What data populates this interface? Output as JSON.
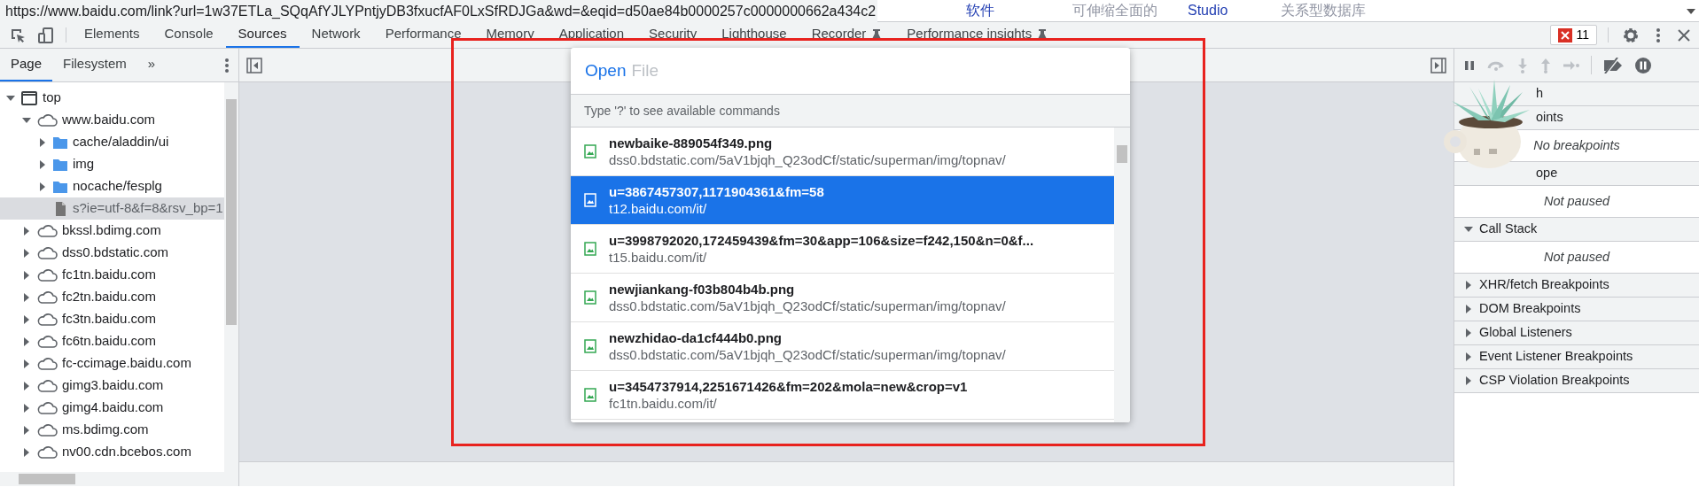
{
  "browser_strip": {
    "url": "https://www.baidu.com/link?url=1w37ETLa_SQqAfYJLYPntjyDB3fxucfAF0LxSfRDJGa&wd=&eqid=d50ae84b0000257c0000000662a434c2",
    "page_texts": [
      {
        "text": "软件",
        "kind": "link"
      },
      {
        "text": "可伸缩全面的",
        "kind": "muted"
      },
      {
        "text": "Studio",
        "kind": "link"
      },
      {
        "text": "关系型数据库",
        "kind": "muted"
      }
    ]
  },
  "devtools_tabs": [
    {
      "label": "Elements",
      "selected": false
    },
    {
      "label": "Console",
      "selected": false
    },
    {
      "label": "Sources",
      "selected": true
    },
    {
      "label": "Network",
      "selected": false
    },
    {
      "label": "Performance",
      "selected": false
    },
    {
      "label": "Memory",
      "selected": false
    },
    {
      "label": "Application",
      "selected": false
    },
    {
      "label": "Security",
      "selected": false
    },
    {
      "label": "Lighthouse",
      "selected": false
    },
    {
      "label": "Recorder",
      "selected": false,
      "experimental": true
    },
    {
      "label": "Performance insights",
      "selected": false,
      "experimental": true
    }
  ],
  "error_count": "11",
  "navigator": {
    "tabs": [
      {
        "label": "Page",
        "selected": true
      },
      {
        "label": "Filesystem",
        "selected": false
      }
    ],
    "more": "»",
    "tree": [
      {
        "label": "top",
        "kind": "frame",
        "expanded": true,
        "selected": false,
        "children": [
          {
            "label": "www.baidu.com",
            "kind": "domain",
            "expanded": true,
            "selected": false,
            "children": [
              {
                "label": "cache/aladdin/ui",
                "kind": "folder",
                "expanded": false,
                "selected": false
              },
              {
                "label": "img",
                "kind": "folder",
                "expanded": false,
                "selected": false
              },
              {
                "label": "nocache/fesplg",
                "kind": "folder",
                "expanded": false,
                "selected": false
              },
              {
                "label": "s?ie=utf-8&f=8&rsv_bp=1",
                "kind": "file",
                "selected": true
              }
            ]
          },
          {
            "label": "bkssl.bdimg.com",
            "kind": "domain",
            "expanded": false,
            "selected": false
          },
          {
            "label": "dss0.bdstatic.com",
            "kind": "domain",
            "expanded": false,
            "selected": false
          },
          {
            "label": "fc1tn.baidu.com",
            "kind": "domain",
            "expanded": false,
            "selected": false
          },
          {
            "label": "fc2tn.baidu.com",
            "kind": "domain",
            "expanded": false,
            "selected": false
          },
          {
            "label": "fc3tn.baidu.com",
            "kind": "domain",
            "expanded": false,
            "selected": false
          },
          {
            "label": "fc6tn.baidu.com",
            "kind": "domain",
            "expanded": false,
            "selected": false
          },
          {
            "label": "fc-ccimage.baidu.com",
            "kind": "domain",
            "expanded": false,
            "selected": false
          },
          {
            "label": "gimg3.baidu.com",
            "kind": "domain",
            "expanded": false,
            "selected": false
          },
          {
            "label": "gimg4.baidu.com",
            "kind": "domain",
            "expanded": false,
            "selected": false
          },
          {
            "label": "ms.bdimg.com",
            "kind": "domain",
            "expanded": false,
            "selected": false
          },
          {
            "label": "nv00.cdn.bcebos.com",
            "kind": "domain",
            "expanded": false,
            "selected": false
          }
        ]
      }
    ]
  },
  "quick_open": {
    "prompt": "Open",
    "placeholder": "File",
    "hint": "Type '?' to see available commands",
    "items": [
      {
        "name": "newbaike-889054f349.png",
        "path": "dss0.bdstatic.com/5aV1bjqh_Q23odCf/static/superman/img/topnav/",
        "selected": false
      },
      {
        "name": "u=3867457307,1171904361&fm=58",
        "path": "t12.baidu.com/it/",
        "selected": true
      },
      {
        "name": "u=3998792020,172459439&fm=30&app=106&size=f242,150&n=0&f...",
        "path": "t15.baidu.com/it/",
        "selected": false
      },
      {
        "name": "newjiankang-f03b804b4b.png",
        "path": "dss0.bdstatic.com/5aV1bjqh_Q23odCf/static/superman/img/topnav/",
        "selected": false
      },
      {
        "name": "newzhidao-da1cf444b0.png",
        "path": "dss0.bdstatic.com/5aV1bjqh_Q23odCf/static/superman/img/topnav/",
        "selected": false
      },
      {
        "name": "u=3454737914,2251671426&fm=202&mola=new&crop=v1",
        "path": "fc1tn.baidu.com/it/",
        "selected": false
      }
    ]
  },
  "debugger": {
    "sections": [
      {
        "title": "h"
      },
      {
        "title": "oints",
        "message": "No breakpoints"
      },
      {
        "title": "ope",
        "message": "Not paused"
      },
      {
        "title": "Call Stack",
        "expanded": true,
        "message": "Not paused"
      },
      {
        "title": "XHR/fetch Breakpoints",
        "expanded": false
      },
      {
        "title": "DOM Breakpoints",
        "expanded": false
      },
      {
        "title": "Global Listeners",
        "expanded": false
      },
      {
        "title": "Event Listener Breakpoints",
        "expanded": false
      },
      {
        "title": "CSP Violation Breakpoints",
        "expanded": false
      }
    ]
  }
}
